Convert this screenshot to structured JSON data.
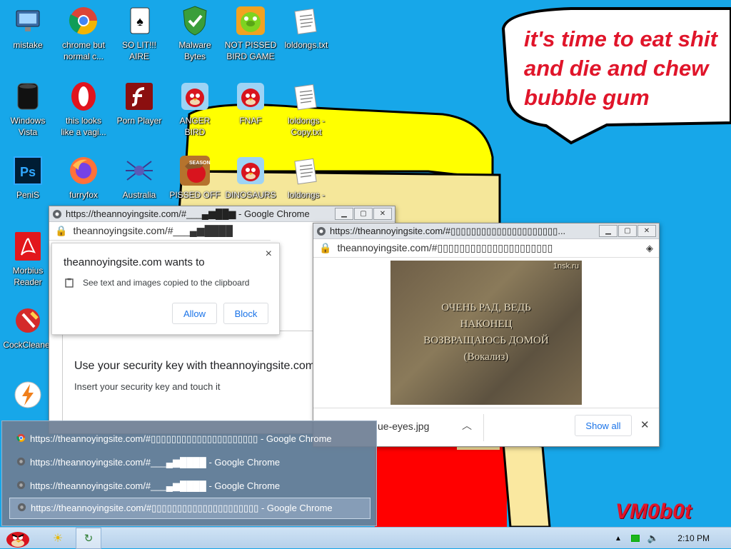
{
  "desktop": {
    "icons": [
      {
        "label": "mistake",
        "icon": "monitor-icon"
      },
      {
        "label": "chrome but\nnormal c...",
        "icon": "chrome-icon"
      },
      {
        "label": "SO LIT!!!\nAIRE",
        "icon": "solitaire-icon"
      },
      {
        "label": "Malware\nBytes",
        "icon": "shield-icon"
      },
      {
        "label": "NOT PISSED\nBIRD GAME",
        "icon": "green-pig-icon"
      },
      {
        "label": "loldongs.txt",
        "icon": "text-file-icon"
      },
      {
        "label": "Windows\nVista",
        "icon": "vista-icon"
      },
      {
        "label": "this looks\nlike a vagi...",
        "icon": "opera-icon"
      },
      {
        "label": "Porn Player",
        "icon": "flash-icon"
      },
      {
        "label": "ANGER\nBIRD",
        "icon": "angry-bird-icon"
      },
      {
        "label": "FNAF",
        "icon": "angry-bird-icon"
      },
      {
        "label": "loldongs -\nCopy.txt",
        "icon": "text-file-icon"
      },
      {
        "label": "PeniS",
        "icon": "photoshop-icon"
      },
      {
        "label": "furryfox",
        "icon": "firefox-icon"
      },
      {
        "label": "Australia",
        "icon": "spider-icon"
      },
      {
        "label": "PISSED OFF",
        "icon": "angry-bird-seasons-icon"
      },
      {
        "label": "DINOSAURS",
        "icon": "angry-bird-icon"
      },
      {
        "label": "loldongs -",
        "icon": "text-file-icon"
      },
      {
        "label": "Morbius\nReader",
        "icon": "pdf-reader-icon"
      },
      {
        "label": "CockCleaner",
        "icon": "ccleaner-icon"
      },
      {
        "label": "",
        "icon": "lightning-icon"
      }
    ],
    "speech_bubble": "it's time to eat shit and die and chew bubble gum",
    "watermark": "VM0b0t"
  },
  "window_left": {
    "title": "https://theannoyingsite.com/#___▄▆██▆ - Google Chrome",
    "address": "theannoyingsite.com/#___▄▆████",
    "security_heading": "Use your security key with theannoyingsite.com",
    "security_sub": "Insert your security key and touch it"
  },
  "permission_popup": {
    "heading": "theannoyingsite.com wants to",
    "request": "See text and images copied to the clipboard",
    "allow": "Allow",
    "block": "Block",
    "close": "×"
  },
  "window_right": {
    "title": "https://theannoyingsite.com/#▯▯▯▯▯▯▯▯▯▯▯▯▯▯▯▯▯▯▯▯▯...",
    "address": "theannoyingsite.com/#▯▯▯▯▯▯▯▯▯▯▯▯▯▯▯▯▯▯▯▯▯",
    "video_lines": [
      "ОЧЕНЬ РАД, ВЕДЬ",
      "НАКОНЕЦ",
      "ВОЗВРАЩАЮСЬ ДОМОЙ",
      "(Вокализ)"
    ],
    "video_badge": "1nsk.ru",
    "download_name": "ue-eyes.jpg",
    "show_all": "Show all",
    "close": "✕"
  },
  "taskbar_group": [
    {
      "label": "https://theannoyingsite.com/#▯▯▯▯▯▯▯▯▯▯▯▯▯▯▯▯▯▯▯▯▯ - Google Chrome",
      "icon": "chrome-icon",
      "selected": false
    },
    {
      "label": "https://theannoyingsite.com/#___▄▆████ - Google Chrome",
      "icon": "chrome-gray-icon",
      "selected": false
    },
    {
      "label": "https://theannoyingsite.com/#___▄▆████ - Google Chrome",
      "icon": "chrome-gray-icon",
      "selected": false
    },
    {
      "label": "https://theannoyingsite.com/#▯▯▯▯▯▯▯▯▯▯▯▯▯▯▯▯▯▯▯▯▯ - Google Chrome",
      "icon": "chrome-gray-icon",
      "selected": true
    }
  ],
  "taskbar": {
    "clock": "2:10 PM"
  },
  "colors": {
    "desktop_bg": "#17a7e9",
    "bubble_text": "#e0152a",
    "chrome_blue": "#1a73e8"
  }
}
